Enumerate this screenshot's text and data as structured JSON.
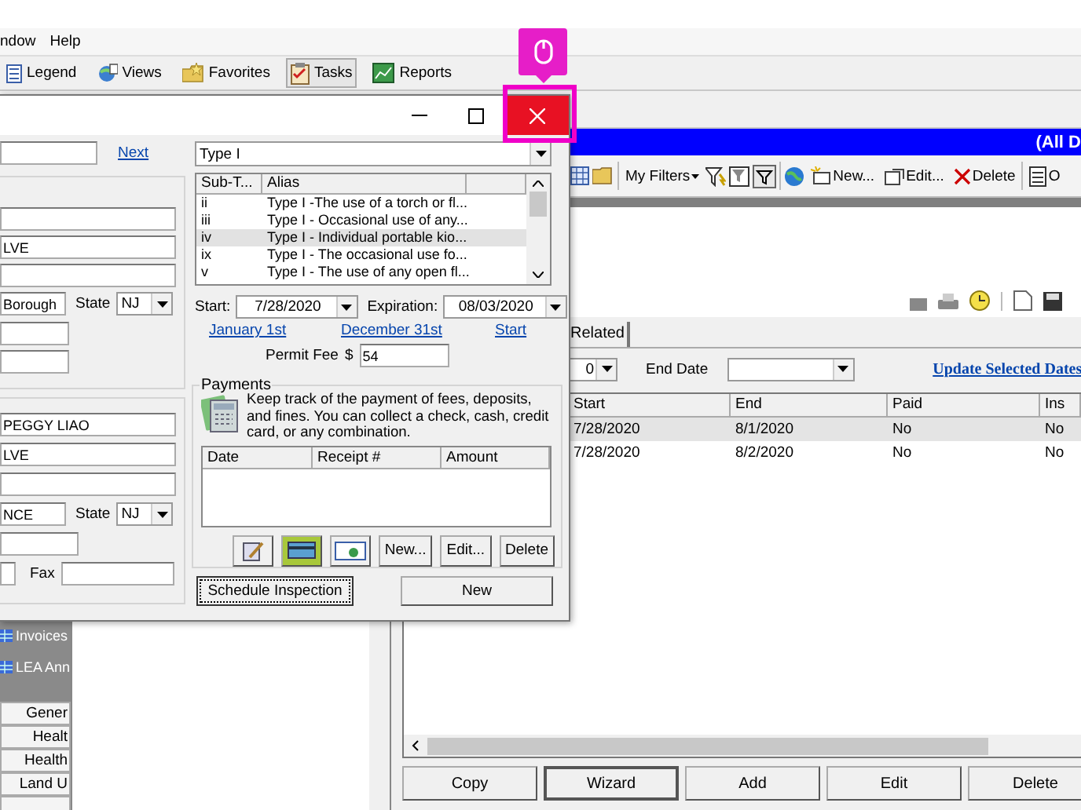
{
  "menu_bar": {
    "items": [
      "ndow",
      "Help"
    ]
  },
  "toolbar": {
    "items": [
      {
        "label": "Legend",
        "selected": false
      },
      {
        "label": "Views",
        "selected": false
      },
      {
        "label": "Favorites",
        "selected": false
      },
      {
        "label": "Tasks",
        "selected": true
      },
      {
        "label": "Reports",
        "selected": false
      }
    ]
  },
  "header_bar": {
    "title": "(All D"
  },
  "list_toolbar": {
    "filters": "My Filters",
    "new": "New...",
    "edit": "Edit...",
    "delete": "Delete",
    "more": "O"
  },
  "tabs": [
    {
      "label": "Related",
      "selected": false
    }
  ],
  "filter": {
    "start_value": "0",
    "end_date_label": "End Date",
    "update_link": "Update Selected Dates"
  },
  "table": {
    "columns": [
      "Start",
      "End",
      "Paid",
      "Ins"
    ],
    "rows": [
      {
        "cells": [
          "7/28/2020",
          "8/1/2020",
          "No",
          "No"
        ],
        "selected": true
      },
      {
        "cells": [
          "7/28/2020",
          "8/2/2020",
          "No",
          "No"
        ],
        "selected": false
      }
    ]
  },
  "bottom_buttons": [
    {
      "label": "Copy",
      "focused": false
    },
    {
      "label": "Wizard",
      "focused": true
    },
    {
      "label": "Add",
      "focused": false
    },
    {
      "label": "Edit",
      "focused": false
    },
    {
      "label": "Delete",
      "focused": false
    }
  ],
  "sidebar": {
    "items": [
      "Invoices",
      "LEA Ann"
    ],
    "buttons": [
      "Gener",
      "Healt",
      "Health",
      "Land U"
    ]
  },
  "dialog": {
    "next_link": "Next",
    "location": {
      "street": "LVE",
      "city": "Borough",
      "state_label": "State",
      "state": "NJ"
    },
    "owner": {
      "name": "PEGGY LIAO",
      "street": "LVE",
      "city": "NCE",
      "state_label": "State",
      "state": "NJ",
      "fax_label": "Fax"
    },
    "type_select": "Type I",
    "subtypes": {
      "columns": [
        "Sub-T...",
        "Alias"
      ],
      "rows": [
        {
          "code": "ii",
          "alias": "Type I -The use of a torch or fl...",
          "selected": false
        },
        {
          "code": "iii",
          "alias": "Type I - Occasional use of any...",
          "selected": false
        },
        {
          "code": "iv",
          "alias": "Type I - Individual portable kio...",
          "selected": true
        },
        {
          "code": "ix",
          "alias": "Type I - The occasional use fo...",
          "selected": false
        },
        {
          "code": "v",
          "alias": "Type I - The use of any open fl...",
          "selected": false
        }
      ]
    },
    "start_label": "Start:",
    "start": "7/28/2020",
    "expiration_label": "Expiration:",
    "expiration": "08/03/2020",
    "links": [
      "January 1st",
      "December 31st",
      "Start"
    ],
    "permit_fee_label": "Permit Fee",
    "currency": "$",
    "permit_fee": "54",
    "payments": {
      "title": "Payments",
      "description": "Keep track of the payment of fees, deposits, and fines. You can collect a check, cash, credit card, or any combination.",
      "columns": [
        "Date",
        "Receipt #",
        "Amount"
      ],
      "buttons": [
        "New...",
        "Edit...",
        "Delete"
      ]
    },
    "schedule_button": "Schedule Inspection",
    "new_button": "New"
  }
}
